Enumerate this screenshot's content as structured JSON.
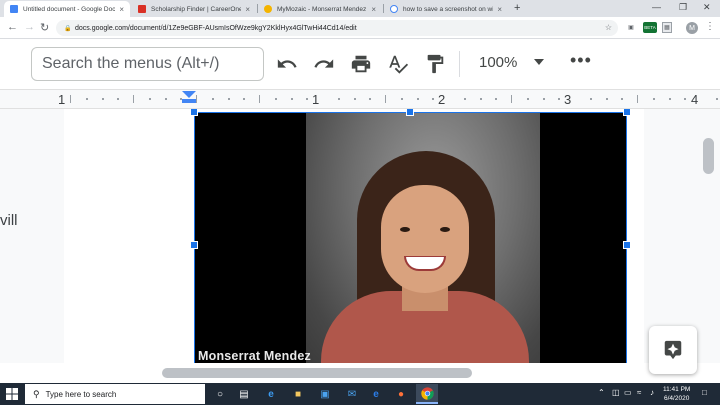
{
  "browser": {
    "tabs": [
      {
        "title": "Untitled document - Google Doc",
        "active": true,
        "favicon_color": "#4285f4"
      },
      {
        "title": "Scholarship Finder | CareerOneSt",
        "active": false,
        "favicon_color": "#d93025"
      },
      {
        "title": "MyMozaic - Monserrat Mendez",
        "active": false,
        "favicon_color": "#f4b400"
      },
      {
        "title": "how to save a screenshot on win",
        "active": false,
        "favicon_color": "#4285f4"
      }
    ],
    "close_glyph": "×",
    "new_tab_glyph": "+",
    "url": "docs.google.com/document/d/1Ze9eGBF-AUsmIsOfWze9kgY2KklHyx4GlTwHi44Cd14/edit",
    "profile_initial": "M",
    "extension_badge": "BETA"
  },
  "docs_toolbar": {
    "menu_search_placeholder": "Search the menus (Alt+/)",
    "zoom": "100%"
  },
  "ruler": {
    "labels": [
      "1",
      "1",
      "2",
      "3",
      "4"
    ]
  },
  "document": {
    "left_text_fragment": "vill",
    "image_caption": "Monserrat Mendez"
  },
  "taskbar": {
    "search_placeholder": "Type here to search",
    "time": "11:41 PM",
    "date": "6/4/2020"
  },
  "colors": {
    "selection_blue": "#1a73e8",
    "taskbar_bg": "#1f2a37",
    "tabstrip_bg": "#dee1e6"
  }
}
